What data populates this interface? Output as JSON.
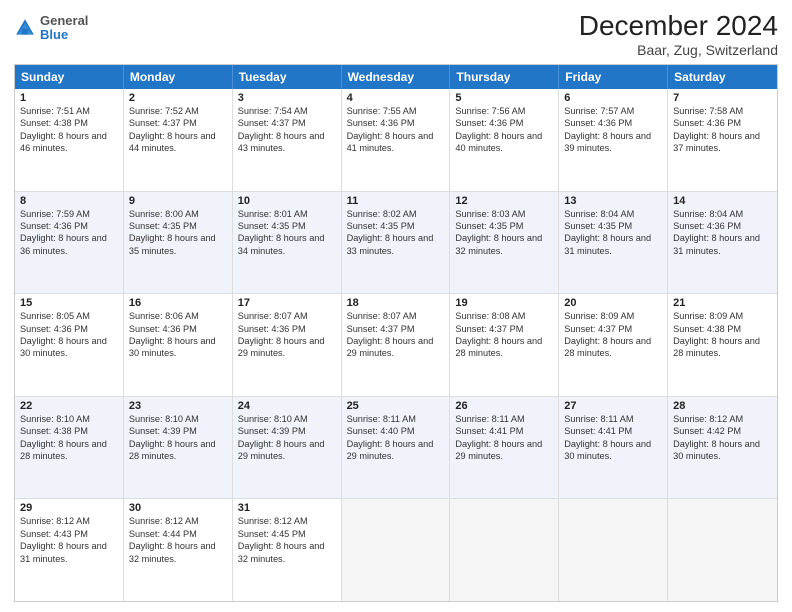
{
  "header": {
    "month_title": "December 2024",
    "location": "Baar, Zug, Switzerland",
    "logo_general": "General",
    "logo_blue": "Blue"
  },
  "days_of_week": [
    "Sunday",
    "Monday",
    "Tuesday",
    "Wednesday",
    "Thursday",
    "Friday",
    "Saturday"
  ],
  "weeks": [
    [
      {
        "day": "1",
        "sunrise": "Sunrise: 7:51 AM",
        "sunset": "Sunset: 4:38 PM",
        "daylight": "Daylight: 8 hours and 46 minutes."
      },
      {
        "day": "2",
        "sunrise": "Sunrise: 7:52 AM",
        "sunset": "Sunset: 4:37 PM",
        "daylight": "Daylight: 8 hours and 44 minutes."
      },
      {
        "day": "3",
        "sunrise": "Sunrise: 7:54 AM",
        "sunset": "Sunset: 4:37 PM",
        "daylight": "Daylight: 8 hours and 43 minutes."
      },
      {
        "day": "4",
        "sunrise": "Sunrise: 7:55 AM",
        "sunset": "Sunset: 4:36 PM",
        "daylight": "Daylight: 8 hours and 41 minutes."
      },
      {
        "day": "5",
        "sunrise": "Sunrise: 7:56 AM",
        "sunset": "Sunset: 4:36 PM",
        "daylight": "Daylight: 8 hours and 40 minutes."
      },
      {
        "day": "6",
        "sunrise": "Sunrise: 7:57 AM",
        "sunset": "Sunset: 4:36 PM",
        "daylight": "Daylight: 8 hours and 39 minutes."
      },
      {
        "day": "7",
        "sunrise": "Sunrise: 7:58 AM",
        "sunset": "Sunset: 4:36 PM",
        "daylight": "Daylight: 8 hours and 37 minutes."
      }
    ],
    [
      {
        "day": "8",
        "sunrise": "Sunrise: 7:59 AM",
        "sunset": "Sunset: 4:36 PM",
        "daylight": "Daylight: 8 hours and 36 minutes."
      },
      {
        "day": "9",
        "sunrise": "Sunrise: 8:00 AM",
        "sunset": "Sunset: 4:35 PM",
        "daylight": "Daylight: 8 hours and 35 minutes."
      },
      {
        "day": "10",
        "sunrise": "Sunrise: 8:01 AM",
        "sunset": "Sunset: 4:35 PM",
        "daylight": "Daylight: 8 hours and 34 minutes."
      },
      {
        "day": "11",
        "sunrise": "Sunrise: 8:02 AM",
        "sunset": "Sunset: 4:35 PM",
        "daylight": "Daylight: 8 hours and 33 minutes."
      },
      {
        "day": "12",
        "sunrise": "Sunrise: 8:03 AM",
        "sunset": "Sunset: 4:35 PM",
        "daylight": "Daylight: 8 hours and 32 minutes."
      },
      {
        "day": "13",
        "sunrise": "Sunrise: 8:04 AM",
        "sunset": "Sunset: 4:35 PM",
        "daylight": "Daylight: 8 hours and 31 minutes."
      },
      {
        "day": "14",
        "sunrise": "Sunrise: 8:04 AM",
        "sunset": "Sunset: 4:36 PM",
        "daylight": "Daylight: 8 hours and 31 minutes."
      }
    ],
    [
      {
        "day": "15",
        "sunrise": "Sunrise: 8:05 AM",
        "sunset": "Sunset: 4:36 PM",
        "daylight": "Daylight: 8 hours and 30 minutes."
      },
      {
        "day": "16",
        "sunrise": "Sunrise: 8:06 AM",
        "sunset": "Sunset: 4:36 PM",
        "daylight": "Daylight: 8 hours and 30 minutes."
      },
      {
        "day": "17",
        "sunrise": "Sunrise: 8:07 AM",
        "sunset": "Sunset: 4:36 PM",
        "daylight": "Daylight: 8 hours and 29 minutes."
      },
      {
        "day": "18",
        "sunrise": "Sunrise: 8:07 AM",
        "sunset": "Sunset: 4:37 PM",
        "daylight": "Daylight: 8 hours and 29 minutes."
      },
      {
        "day": "19",
        "sunrise": "Sunrise: 8:08 AM",
        "sunset": "Sunset: 4:37 PM",
        "daylight": "Daylight: 8 hours and 28 minutes."
      },
      {
        "day": "20",
        "sunrise": "Sunrise: 8:09 AM",
        "sunset": "Sunset: 4:37 PM",
        "daylight": "Daylight: 8 hours and 28 minutes."
      },
      {
        "day": "21",
        "sunrise": "Sunrise: 8:09 AM",
        "sunset": "Sunset: 4:38 PM",
        "daylight": "Daylight: 8 hours and 28 minutes."
      }
    ],
    [
      {
        "day": "22",
        "sunrise": "Sunrise: 8:10 AM",
        "sunset": "Sunset: 4:38 PM",
        "daylight": "Daylight: 8 hours and 28 minutes."
      },
      {
        "day": "23",
        "sunrise": "Sunrise: 8:10 AM",
        "sunset": "Sunset: 4:39 PM",
        "daylight": "Daylight: 8 hours and 28 minutes."
      },
      {
        "day": "24",
        "sunrise": "Sunrise: 8:10 AM",
        "sunset": "Sunset: 4:39 PM",
        "daylight": "Daylight: 8 hours and 29 minutes."
      },
      {
        "day": "25",
        "sunrise": "Sunrise: 8:11 AM",
        "sunset": "Sunset: 4:40 PM",
        "daylight": "Daylight: 8 hours and 29 minutes."
      },
      {
        "day": "26",
        "sunrise": "Sunrise: 8:11 AM",
        "sunset": "Sunset: 4:41 PM",
        "daylight": "Daylight: 8 hours and 29 minutes."
      },
      {
        "day": "27",
        "sunrise": "Sunrise: 8:11 AM",
        "sunset": "Sunset: 4:41 PM",
        "daylight": "Daylight: 8 hours and 30 minutes."
      },
      {
        "day": "28",
        "sunrise": "Sunrise: 8:12 AM",
        "sunset": "Sunset: 4:42 PM",
        "daylight": "Daylight: 8 hours and 30 minutes."
      }
    ],
    [
      {
        "day": "29",
        "sunrise": "Sunrise: 8:12 AM",
        "sunset": "Sunset: 4:43 PM",
        "daylight": "Daylight: 8 hours and 31 minutes."
      },
      {
        "day": "30",
        "sunrise": "Sunrise: 8:12 AM",
        "sunset": "Sunset: 4:44 PM",
        "daylight": "Daylight: 8 hours and 32 minutes."
      },
      {
        "day": "31",
        "sunrise": "Sunrise: 8:12 AM",
        "sunset": "Sunset: 4:45 PM",
        "daylight": "Daylight: 8 hours and 32 minutes."
      },
      null,
      null,
      null,
      null
    ]
  ]
}
